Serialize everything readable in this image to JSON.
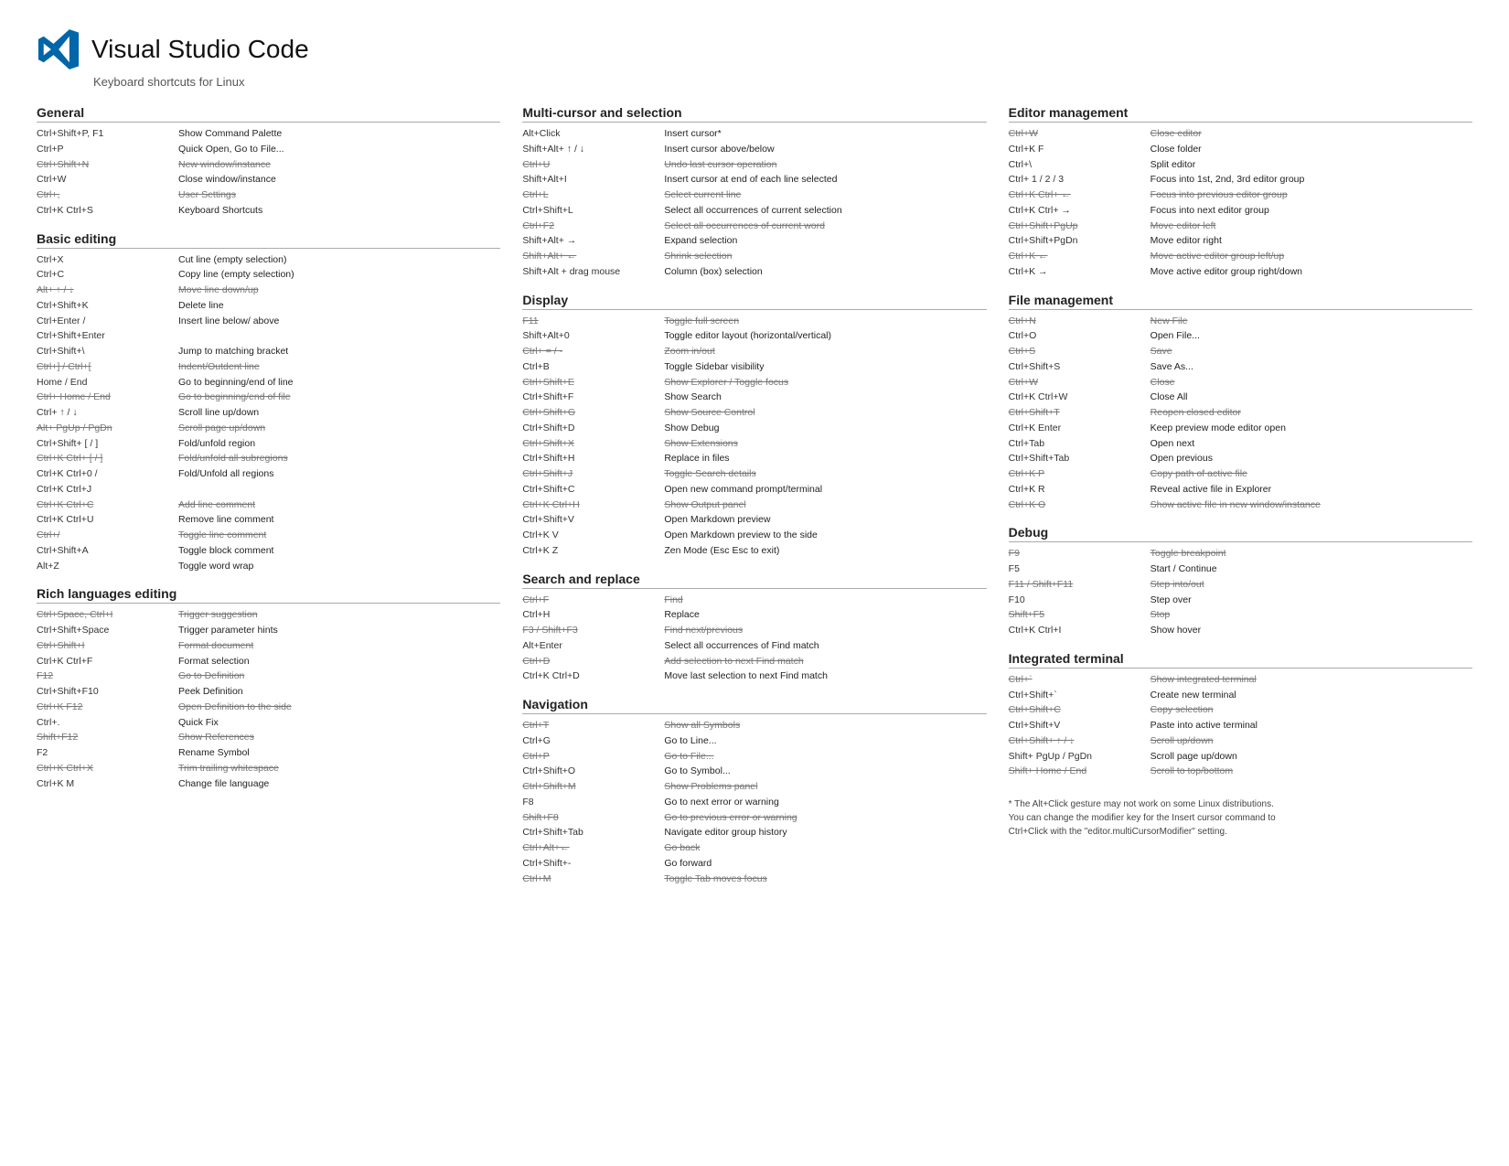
{
  "header": {
    "title": "Visual Studio Code",
    "subtitle": "Keyboard shortcuts for Linux"
  },
  "sections": {
    "col1": [
      {
        "title": "General",
        "items": [
          {
            "key": "Ctrl+Shift+P, F1",
            "desc": "Show Command Palette",
            "strike": false
          },
          {
            "key": "Ctrl+P",
            "desc": "Quick Open, Go to File...",
            "strike": false
          },
          {
            "key": "Ctrl+Shift+N",
            "desc": "New window/instance",
            "strike": true
          },
          {
            "key": "Ctrl+W",
            "desc": "Close window/instance",
            "strike": false
          },
          {
            "key": "Ctrl+,",
            "desc": "User Settings",
            "strike": true
          },
          {
            "key": "Ctrl+K Ctrl+S",
            "desc": "Keyboard Shortcuts",
            "strike": false
          }
        ]
      },
      {
        "title": "Basic editing",
        "items": [
          {
            "key": "Ctrl+X",
            "desc": "Cut line (empty selection)",
            "strike": false
          },
          {
            "key": "Ctrl+C",
            "desc": "Copy line (empty selection)",
            "strike": false
          },
          {
            "key": "Alt+ ↑ / ↓",
            "desc": "Move line down/up",
            "strike": true
          },
          {
            "key": "Ctrl+Shift+K",
            "desc": "Delete line",
            "strike": false
          },
          {
            "key": "Ctrl+Enter /",
            "desc": "Insert line below/ above",
            "strike": false
          },
          {
            "key": "Ctrl+Shift+Enter",
            "desc": "",
            "strike": false
          },
          {
            "key": "Ctrl+Shift+\\",
            "desc": "Jump to matching bracket",
            "strike": false
          },
          {
            "key": "Ctrl+] / Ctrl+[",
            "desc": "Indent/Outdent line",
            "strike": true
          },
          {
            "key": "Home / End",
            "desc": "Go to beginning/end of line",
            "strike": false
          },
          {
            "key": "Ctrl+ Home / End",
            "desc": "Go to beginning/end of file",
            "strike": true
          },
          {
            "key": "Ctrl+ ↑ / ↓",
            "desc": "Scroll line up/down",
            "strike": false
          },
          {
            "key": "Alt+ PgUp / PgDn",
            "desc": "Scroll page up/down",
            "strike": true
          },
          {
            "key": "Ctrl+Shift+ [ / ]",
            "desc": "Fold/unfold region",
            "strike": false
          },
          {
            "key": "Ctrl+K Ctrl+ [ / ]",
            "desc": "Fold/unfold all subregions",
            "strike": true
          },
          {
            "key": "Ctrl+K Ctrl+0 /",
            "desc": "Fold/Unfold all regions",
            "strike": false
          },
          {
            "key": "Ctrl+K Ctrl+J",
            "desc": "",
            "strike": false
          },
          {
            "key": "Ctrl+K Ctrl+C",
            "desc": "Add line comment",
            "strike": true
          },
          {
            "key": "Ctrl+K Ctrl+U",
            "desc": "Remove line comment",
            "strike": false
          },
          {
            "key": "Ctrl+/",
            "desc": "Toggle line comment",
            "strike": true
          },
          {
            "key": "Ctrl+Shift+A",
            "desc": "Toggle block comment",
            "strike": false
          },
          {
            "key": "Alt+Z",
            "desc": "Toggle word wrap",
            "strike": false
          }
        ]
      },
      {
        "title": "Rich languages editing",
        "items": [
          {
            "key": "Ctrl+Space, Ctrl+I",
            "desc": "Trigger suggestion",
            "strike": true
          },
          {
            "key": "Ctrl+Shift+Space",
            "desc": "Trigger parameter hints",
            "strike": false
          },
          {
            "key": "Ctrl+Shift+I",
            "desc": "Format document",
            "strike": true
          },
          {
            "key": "Ctrl+K Ctrl+F",
            "desc": "Format selection",
            "strike": false
          },
          {
            "key": "F12",
            "desc": "Go to Definition",
            "strike": true
          },
          {
            "key": "Ctrl+Shift+F10",
            "desc": "Peek Definition",
            "strike": false
          },
          {
            "key": "Ctrl+K F12",
            "desc": "Open Definition to the side",
            "strike": true
          },
          {
            "key": "Ctrl+.",
            "desc": "Quick Fix",
            "strike": false
          },
          {
            "key": "Shift+F12",
            "desc": "Show References",
            "strike": true
          },
          {
            "key": "F2",
            "desc": "Rename Symbol",
            "strike": false
          },
          {
            "key": "Ctrl+K Ctrl+X",
            "desc": "Trim trailing whitespace",
            "strike": true
          },
          {
            "key": "Ctrl+K M",
            "desc": "Change file language",
            "strike": false
          }
        ]
      }
    ],
    "col2": [
      {
        "title": "Multi-cursor and selection",
        "items": [
          {
            "key": "Alt+Click",
            "desc": "Insert cursor*",
            "strike": false
          },
          {
            "key": "Shift+Alt+ ↑ / ↓",
            "desc": "Insert cursor above/below",
            "strike": false
          },
          {
            "key": "Ctrl+U",
            "desc": "Undo last cursor operation",
            "strike": true
          },
          {
            "key": "Shift+Alt+I",
            "desc": "Insert cursor at end of each line selected",
            "strike": false
          },
          {
            "key": "Ctrl+L",
            "desc": "Select current line",
            "strike": true
          },
          {
            "key": "Ctrl+Shift+L",
            "desc": "Select all occurrences of current selection",
            "strike": false
          },
          {
            "key": "Ctrl+F2",
            "desc": "Select all occurrences of current word",
            "strike": true
          },
          {
            "key": "Shift+Alt+ →",
            "desc": "Expand selection",
            "strike": false
          },
          {
            "key": "Shift+Alt+ ←",
            "desc": "Shrink selection",
            "strike": true
          },
          {
            "key": "Shift+Alt + drag mouse",
            "desc": "Column (box) selection",
            "strike": false
          }
        ]
      },
      {
        "title": "Display",
        "items": [
          {
            "key": "F11",
            "desc": "Toggle full screen",
            "strike": true
          },
          {
            "key": "Shift+Alt+0",
            "desc": "Toggle editor layout (horizontal/vertical)",
            "strike": false
          },
          {
            "key": "Ctrl+ = / -",
            "desc": "Zoom in/out",
            "strike": true
          },
          {
            "key": "Ctrl+B",
            "desc": "Toggle Sidebar visibility",
            "strike": false
          },
          {
            "key": "Ctrl+Shift+E",
            "desc": "Show Explorer / Toggle focus",
            "strike": true
          },
          {
            "key": "Ctrl+Shift+F",
            "desc": "Show Search",
            "strike": false
          },
          {
            "key": "Ctrl+Shift+G",
            "desc": "Show Source Control",
            "strike": true
          },
          {
            "key": "Ctrl+Shift+D",
            "desc": "Show Debug",
            "strike": false
          },
          {
            "key": "Ctrl+Shift+X",
            "desc": "Show Extensions",
            "strike": true
          },
          {
            "key": "Ctrl+Shift+H",
            "desc": "Replace in files",
            "strike": false
          },
          {
            "key": "Ctrl+Shift+J",
            "desc": "Toggle Search details",
            "strike": true
          },
          {
            "key": "Ctrl+Shift+C",
            "desc": "Open new command prompt/terminal",
            "strike": false
          },
          {
            "key": "Ctrl+K Ctrl+H",
            "desc": "Show Output panel",
            "strike": true
          },
          {
            "key": "Ctrl+Shift+V",
            "desc": "Open Markdown preview",
            "strike": false
          },
          {
            "key": "Ctrl+K V",
            "desc": "Open Markdown preview to the side",
            "strike": false
          },
          {
            "key": "Ctrl+K Z",
            "desc": "Zen Mode (Esc Esc to exit)",
            "strike": false
          }
        ]
      },
      {
        "title": "Search and replace",
        "items": [
          {
            "key": "Ctrl+F",
            "desc": "Find",
            "strike": true
          },
          {
            "key": "Ctrl+H",
            "desc": "Replace",
            "strike": false
          },
          {
            "key": "F3 / Shift+F3",
            "desc": "Find next/previous",
            "strike": true
          },
          {
            "key": "Alt+Enter",
            "desc": "Select all occurrences of Find match",
            "strike": false
          },
          {
            "key": "Ctrl+D",
            "desc": "Add selection to next Find match",
            "strike": true
          },
          {
            "key": "Ctrl+K Ctrl+D",
            "desc": "Move last selection to next Find match",
            "strike": false
          }
        ]
      },
      {
        "title": "Navigation",
        "items": [
          {
            "key": "Ctrl+T",
            "desc": "Show all Symbols",
            "strike": true
          },
          {
            "key": "Ctrl+G",
            "desc": "Go to Line...",
            "strike": false
          },
          {
            "key": "Ctrl+P",
            "desc": "Go to File...",
            "strike": true
          },
          {
            "key": "Ctrl+Shift+O",
            "desc": "Go to Symbol...",
            "strike": false
          },
          {
            "key": "Ctrl+Shift+M",
            "desc": "Show Problems panel",
            "strike": true
          },
          {
            "key": "F8",
            "desc": "Go to next error or warning",
            "strike": false
          },
          {
            "key": "Shift+F8",
            "desc": "Go to previous error or warning",
            "strike": true
          },
          {
            "key": "Ctrl+Shift+Tab",
            "desc": "Navigate editor group history",
            "strike": false
          },
          {
            "key": "Ctrl+Alt+←",
            "desc": "Go back",
            "strike": true
          },
          {
            "key": "Ctrl+Shift+-",
            "desc": "Go forward",
            "strike": false
          },
          {
            "key": "Ctrl+M",
            "desc": "Toggle Tab moves focus",
            "strike": true
          }
        ]
      }
    ],
    "col3": [
      {
        "title": "Editor management",
        "items": [
          {
            "key": "Ctrl+W",
            "desc": "Close editor",
            "strike": true
          },
          {
            "key": "Ctrl+K F",
            "desc": "Close folder",
            "strike": false
          },
          {
            "key": "Ctrl+\\",
            "desc": "Split editor",
            "strike": false
          },
          {
            "key": "Ctrl+ 1 / 2 / 3",
            "desc": "Focus into 1st, 2nd, 3rd editor group",
            "strike": false
          },
          {
            "key": "Ctrl+K Ctrl+ ←",
            "desc": "Focus into previous editor group",
            "strike": true
          },
          {
            "key": "Ctrl+K Ctrl+ →",
            "desc": "Focus into next editor group",
            "strike": false
          },
          {
            "key": "Ctrl+Shift+PgUp",
            "desc": "Move editor left",
            "strike": true
          },
          {
            "key": "Ctrl+Shift+PgDn",
            "desc": "Move editor right",
            "strike": false
          },
          {
            "key": "Ctrl+K ←",
            "desc": "Move active editor group left/up",
            "strike": true
          },
          {
            "key": "Ctrl+K →",
            "desc": "Move active editor group right/down",
            "strike": false
          }
        ]
      },
      {
        "title": "File management",
        "items": [
          {
            "key": "Ctrl+N",
            "desc": "New File",
            "strike": true
          },
          {
            "key": "Ctrl+O",
            "desc": "Open File...",
            "strike": false
          },
          {
            "key": "Ctrl+S",
            "desc": "Save",
            "strike": true
          },
          {
            "key": "Ctrl+Shift+S",
            "desc": "Save As...",
            "strike": false
          },
          {
            "key": "Ctrl+W",
            "desc": "Close",
            "strike": true
          },
          {
            "key": "Ctrl+K Ctrl+W",
            "desc": "Close All",
            "strike": false
          },
          {
            "key": "Ctrl+Shift+T",
            "desc": "Reopen closed editor",
            "strike": true
          },
          {
            "key": "Ctrl+K Enter",
            "desc": "Keep preview mode editor open",
            "strike": false
          },
          {
            "key": "Ctrl+Tab",
            "desc": "Open next",
            "strike": false
          },
          {
            "key": "Ctrl+Shift+Tab",
            "desc": "Open previous",
            "strike": false
          },
          {
            "key": "Ctrl+K P",
            "desc": "Copy path of active file",
            "strike": true
          },
          {
            "key": "Ctrl+K R",
            "desc": "Reveal active file in Explorer",
            "strike": false
          },
          {
            "key": "Ctrl+K O",
            "desc": "Show active file in new window/instance",
            "strike": true
          }
        ]
      },
      {
        "title": "Debug",
        "items": [
          {
            "key": "F9",
            "desc": "Toggle breakpoint",
            "strike": true
          },
          {
            "key": "F5",
            "desc": "Start / Continue",
            "strike": false
          },
          {
            "key": "F11 / Shift+F11",
            "desc": "Step into/out",
            "strike": true
          },
          {
            "key": "F10",
            "desc": "Step over",
            "strike": false
          },
          {
            "key": "Shift+F5",
            "desc": "Stop",
            "strike": true
          },
          {
            "key": "Ctrl+K Ctrl+I",
            "desc": "Show hover",
            "strike": false
          }
        ]
      },
      {
        "title": "Integrated terminal",
        "items": [
          {
            "key": "Ctrl+`",
            "desc": "Show integrated terminal",
            "strike": true
          },
          {
            "key": "Ctrl+Shift+`",
            "desc": "Create new terminal",
            "strike": false
          },
          {
            "key": "Ctrl+Shift+C",
            "desc": "Copy selection",
            "strike": true
          },
          {
            "key": "Ctrl+Shift+V",
            "desc": "Paste into active terminal",
            "strike": false
          },
          {
            "key": "Ctrl+Shift+ ↑ / ↓",
            "desc": "Scroll up/down",
            "strike": true
          },
          {
            "key": "Shift+ PgUp / PgDn",
            "desc": "Scroll page up/down",
            "strike": false
          },
          {
            "key": "Shift+ Home / End",
            "desc": "Scroll to top/bottom",
            "strike": true
          }
        ]
      }
    ]
  },
  "footnote": "* The Alt+Click gesture may not work on some Linux distributions.\nYou can change the modifier key for the Insert cursor command to\nCtrl+Click with the \"editor.multiCursorModifier\" setting."
}
